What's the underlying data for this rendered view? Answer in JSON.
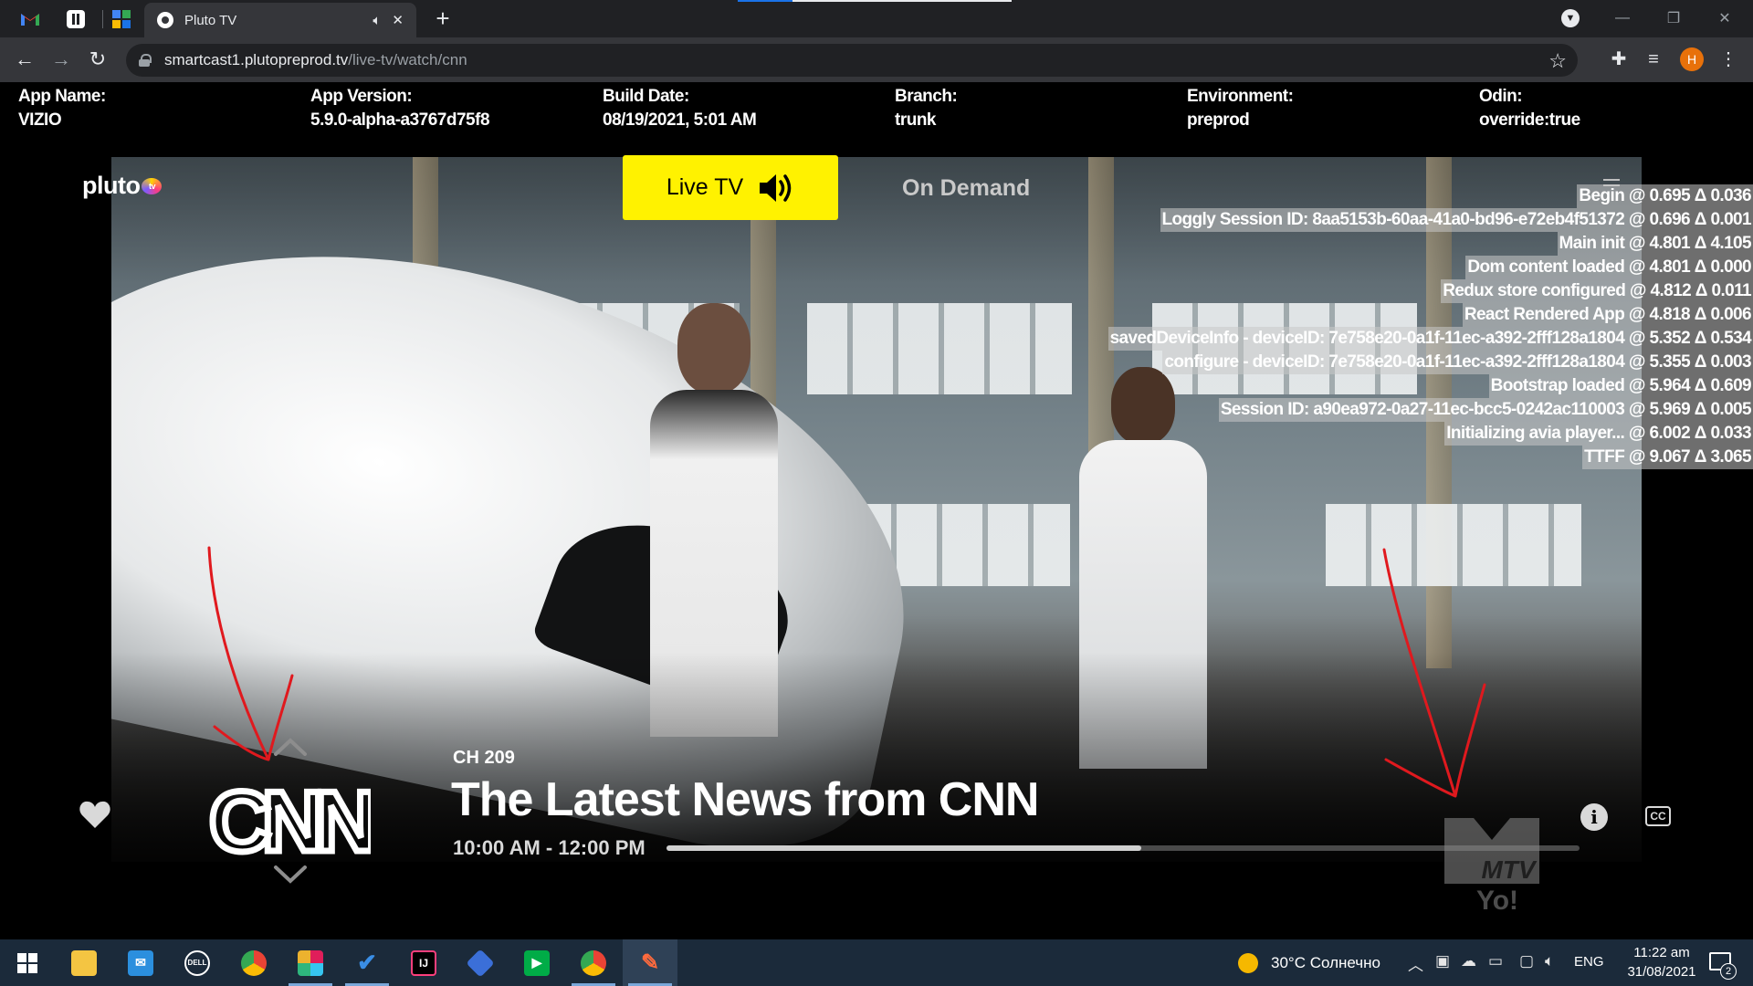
{
  "browser": {
    "tab_title": "Pluto TV",
    "url_host": "smartcast1.plutopreprod.tv",
    "url_path": "/live-tv/watch/cnn",
    "profile_initial": "H"
  },
  "debug": {
    "fields": [
      {
        "label": "App Name:",
        "value": "VIZIO"
      },
      {
        "label": "App Version:",
        "value": "5.9.0-alpha-a3767d75f8"
      },
      {
        "label": "Build Date:",
        "value": "08/19/2021, 5:01 AM"
      },
      {
        "label": "Branch:",
        "value": "trunk"
      },
      {
        "label": "Environment:",
        "value": "preprod"
      },
      {
        "label": "Odin:",
        "value": "override:true"
      }
    ]
  },
  "app": {
    "logo_text": "pluto",
    "logo_badge": "tv",
    "nav": {
      "live_tv": "Live TV",
      "on_demand": "On Demand"
    },
    "perf_log": [
      "Begin @ 0.695 Δ 0.036",
      "Loggly Session ID: 8aa5153b-60aa-41a0-bd96-e72eb4f51372 @ 0.696 Δ 0.001",
      "Main init @ 4.801 Δ 4.105",
      "Dom content loaded @ 4.801 Δ 0.000",
      "Redux store configured @ 4.812 Δ 0.011",
      "React Rendered App @ 4.818 Δ 0.006",
      "savedDeviceInfo - deviceID: 7e758e20-0a1f-11ec-a392-2fff128a1804 @ 5.352 Δ 0.534",
      "configure - deviceID: 7e758e20-0a1f-11ec-a392-2fff128a1804 @ 5.355 Δ 0.003",
      "Bootstrap loaded @ 5.964 Δ 0.609",
      "Session ID: a90ea972-0a27-11ec-bcc5-0242ac110003 @ 5.969 Δ 0.005",
      "Initializing avia player... @ 6.002 Δ 0.033",
      "TTFF @ 9.067 Δ 3.065"
    ],
    "guide": {
      "channel_logo": "CNN",
      "channel_number": "CH 209",
      "program_title": "The Latest News from CNN",
      "program_time": "10:00 AM - 12:00 PM",
      "progress": 0.52,
      "cc_label": "CC",
      "info_label": "i",
      "watermark": "MTV Yo!"
    }
  },
  "taskbar": {
    "apps": [
      "file-explorer",
      "mail",
      "dell",
      "chrome",
      "slack",
      "todo",
      "intellij",
      "virtualbox",
      "google-meet",
      "chrome-profile",
      "paint"
    ],
    "weather": "30°C  Солнечно",
    "language": "ENG",
    "time": "11:22 am",
    "date": "31/08/2021",
    "notifications": "2"
  },
  "colors": {
    "live_tv_yellow": "#fff200",
    "annotation_red": "#e0191e",
    "profile_orange": "#e8710a"
  }
}
